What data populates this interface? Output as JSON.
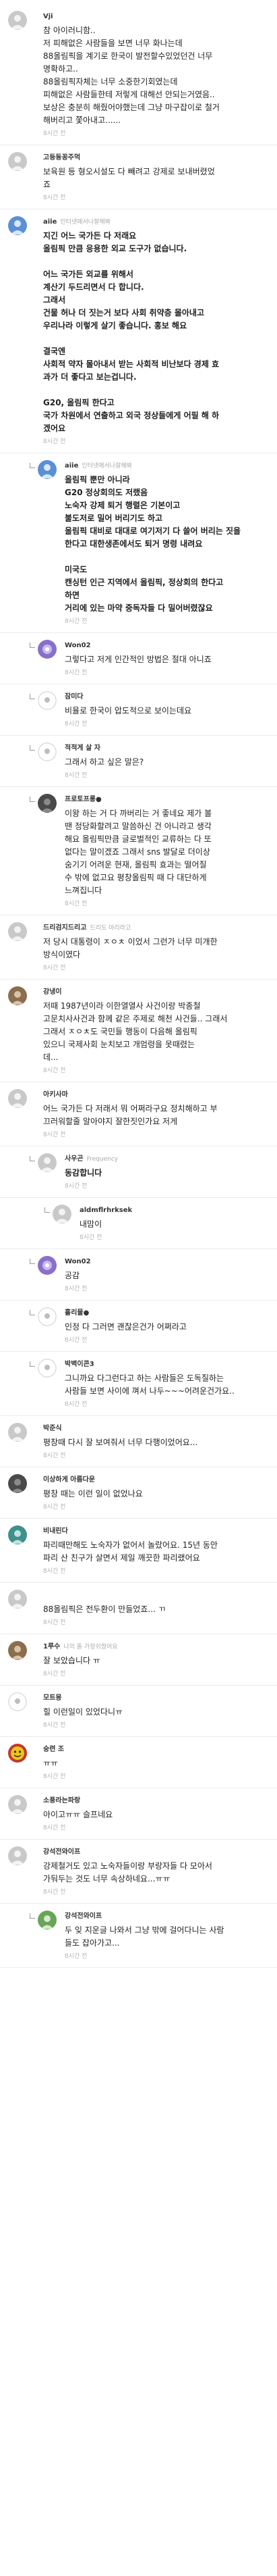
{
  "comments": [
    {
      "name": "Vji",
      "meta": "",
      "lines": [
        "참 아이러니함..",
        "저 피해없은 사람들을 보면 너무 화나는데",
        "88올림픽을 계기로 한국이 발전할수있었던건 너무",
        "명확하고..",
        "88올림픽자체는 너무 소중한기회였는데",
        "피해없은 사람들한테 저렇게 대해선 안되는거였음..",
        "보상은 충분히 해줬어야했는데 그냥 마구잡이로 철거",
        "해버리고 쫓아내고......"
      ],
      "time": "8시간 전",
      "avatar": "grey",
      "bold": false,
      "depth": 0
    },
    {
      "name": "고등동꽁주먹",
      "meta": "",
      "lines": [
        "보육원 등 형오시설도 다 빼려고 강제로 보내버렸었",
        "죠"
      ],
      "time": "8시간 전",
      "avatar": "grey",
      "bold": false,
      "depth": 0
    },
    {
      "name": "aiie",
      "meta": "인터넷에서나잘해봐",
      "lines": [
        "지긴 어느 국가든 다 저래요",
        "올림픽 만큼 응용한 외교 도구가 없습니다.",
        "",
        "어느 국가든 외교를 위해서",
        "계산기 두드리면서 다 합니다.",
        "그래서",
        "건물 허나 더 짓는거 보다 사회 취약층 몰아내고",
        "우리나라 이렇게 살기 좋습니다. 홍보 해요",
        "",
        "결국엔",
        "사회적 약자 몰아내서 받는 사회적 비난보다 경제 효",
        "과가 더 좋다고 보는겁니다.",
        "",
        "G20, 올림픽 한다고",
        "국가 차원에서 연출하고 외국 정상들에게 어필 해 하",
        "겠어요"
      ],
      "time": "8시간 전",
      "avatar": "blue",
      "bold": true,
      "depth": 0
    },
    {
      "name": "aiie",
      "meta": "인터넷에서나잘해봐",
      "lines": [
        "올림픽 뿐만 아니라",
        "G20 정상회의도 저랬음",
        "노숙자 강제 퇴거 행렬은 기본이고",
        "불도저로 밀어 버리기도 하고",
        "올림픽 대비로 대대로 여기저기 다 쓸어 버리는 짓을",
        "한다고 대한생존에서도 퇴거 명령 내려요",
        "",
        "미국도",
        "캔싱턴 인근 지역에서 올림픽, 정상회의 한다고",
        "하면",
        "거리에 있는 마약 중독자들 다 밀어버렸잖요"
      ],
      "time": "8시간 전",
      "avatar": "blue",
      "bold": true,
      "depth": 1
    },
    {
      "name": "Won02",
      "meta": "",
      "lines": [
        "그렇다고 저게 인간적인 방법은 절대 아니죠"
      ],
      "time": "8시간 전",
      "avatar": "purple",
      "bold": false,
      "depth": 1
    },
    {
      "name": "잠미다",
      "meta": "",
      "lines": [
        "비율로 한국이 압도적으로 보이는데요"
      ],
      "time": "8시간 전",
      "avatar": "white",
      "bold": false,
      "depth": 1
    },
    {
      "name": "적적게 살 자",
      "meta": "",
      "lines": [
        "그래서 하고 싶은 말은?"
      ],
      "time": "8시간 전",
      "avatar": "white",
      "bold": false,
      "depth": 1
    },
    {
      "name": "프로토프롱●",
      "meta": "",
      "lines": [
        "이왕 하는 거 다 까버리는 거 좋네요 제가 볼",
        "땐 정당화할려고 말씀하신 건 아니라고 생각",
        "해요 올림픽만큼 글로벌적인 교류하는 다 또",
        "없다는 말이겠죠 그래서 sns 발달로 더이상",
        "숨기기 어려운 현재, 올림픽 효과는 떨어질",
        "수 밖에 없고요 평창올림픽 때 다 대단하게",
        "느껴집니다"
      ],
      "time": "8시간 전",
      "avatar": "dark",
      "bold": false,
      "depth": 1
    },
    {
      "name": "드리검지드리고",
      "meta": "드리도 아리라고",
      "lines": [
        "저 당시 대통령이 ㅈㅇㅊ 이었서 그런가 너무 미개한",
        "방식이였다"
      ],
      "time": "8시간 전",
      "avatar": "grey",
      "bold": false,
      "depth": 0
    },
    {
      "name": "강냉이",
      "meta": "",
      "lines": [
        "저때 1987년이라 이한열열사 사건이랑 박종철",
        "고문치사사건과 함께 같은 주제로 해천 사건들.. 그래서",
        "그래서 ㅈㅇㅊ도 국민들 행동이 다음해 올림픽",
        "있으니 국제사회 눈치보고 개엄령을 못때렸는",
        "데..."
      ],
      "time": "8시간 전",
      "avatar": "brown",
      "bold": false,
      "depth": 0
    },
    {
      "name": "아키사마",
      "meta": "",
      "lines": [
        "어느 국가든 다 저래서 뭐 어쩌라구요 정치해하고 부",
        "끄러워할줄 알아야지 잘한짓인가요 저게"
      ],
      "time": "8시간 전",
      "avatar": "grey",
      "bold": false,
      "depth": 0
    },
    {
      "name": "사우곤",
      "meta": "Frequency",
      "lines": [
        "동감합니다"
      ],
      "time": "8시간 전",
      "avatar": "grey",
      "bold": true,
      "depth": 1
    },
    {
      "name": "aldmflrhrksek",
      "meta": "",
      "lines": [
        "내맘이"
      ],
      "time": "8시간 전",
      "avatar": "grey",
      "bold": false,
      "depth": 2
    },
    {
      "name": "Won02",
      "meta": "",
      "lines": [
        "공감"
      ],
      "time": "8시간 전",
      "avatar": "purple",
      "bold": false,
      "depth": 1
    },
    {
      "name": "홀리물●",
      "meta": "",
      "lines": [
        "인정 다 그러면 괜찮은건가 어쩌라고"
      ],
      "time": "8시간 전",
      "avatar": "white",
      "bold": false,
      "depth": 1
    },
    {
      "name": "박벽이콘3",
      "meta": "",
      "lines": [
        "그니까요 다그런다고 하는 사람들은 도독질하는",
        "사람들 보면 사이에 껴서 나두~~~어려운건가요.."
      ],
      "time": "8시간 전",
      "avatar": "white",
      "bold": false,
      "depth": 1
    },
    {
      "name": "박준식",
      "meta": "",
      "lines": [
        "평창때 다시 잘 보여줘서 너무 다행이었어요..."
      ],
      "time": "8시간 전",
      "avatar": "grey",
      "bold": false,
      "depth": 0
    },
    {
      "name": "이상하게 아름다운",
      "meta": "",
      "lines": [
        "평창 때는 이런 일이 없었나요"
      ],
      "time": "8시간 전",
      "avatar": "dark",
      "bold": false,
      "depth": 0
    },
    {
      "name": "비내린다",
      "meta": "",
      "lines": [
        "파리때만해도 노숙자가 없어서 놀랐어요. 15년 동안",
        "파리 산 친구가 살면서 제일 깨끗한 파리랬어요"
      ],
      "time": "8시간 전",
      "avatar": "teal",
      "bold": false,
      "depth": 0
    },
    {
      "name": "",
      "meta": "",
      "lines": [
        "88올림픽은 전두환이 만들었죠... ㄲ"
      ],
      "time": "8시간 전",
      "avatar": "grey",
      "bold": false,
      "depth": 0
    },
    {
      "name": "1루수",
      "meta": "나의 돌 가장쉬웠어요",
      "lines": [
        "잘 보았습니다 ㅠ"
      ],
      "time": "8시간 전",
      "avatar": "brown",
      "bold": false,
      "depth": 0
    },
    {
      "name": "모트몽",
      "meta": "",
      "lines": [
        "힐 이런일이 있었다니ㅠ"
      ],
      "time": "8시간 전",
      "avatar": "white",
      "bold": false,
      "depth": 0
    },
    {
      "name": "숭련 조",
      "meta": "",
      "lines": [
        "ㅠㅠ"
      ],
      "time": "8시간 전",
      "avatar": "red",
      "bold": false,
      "depth": 0
    },
    {
      "name": "소풍라는파랑",
      "meta": "",
      "lines": [
        "아이고ㅠㅠ 슬프네요"
      ],
      "time": "8시간 전",
      "avatar": "grey",
      "bold": false,
      "depth": 0
    },
    {
      "name": "강석전와이프",
      "meta": "",
      "lines": [
        "강제철거도 있고 노숙자들이랑 부랑자들 다 모아서",
        "가둬두는 것도 너무 속상하네요...ㅠㅠ"
      ],
      "time": "8시간 전",
      "avatar": "grey",
      "bold": false,
      "depth": 0
    },
    {
      "name": "강석전와이프",
      "meta": "",
      "lines": [
        "두 잊 지운글 나와서 그냥 밖에 걸어다니는 사람",
        "들도 잡아가고..."
      ],
      "time": "8시간 전",
      "avatar": "green",
      "bold": false,
      "depth": 1
    }
  ],
  "avatar_colors": {
    "grey": "#c9c9c9",
    "blue": "#5b8fd6",
    "purple": "#8a6fc9",
    "white": "#e9e9e9",
    "dark": "#4a4a4a",
    "brown": "#8b6d4f",
    "teal": "#3f8f8a",
    "red": "#c0392b",
    "green": "#6aa35a"
  }
}
